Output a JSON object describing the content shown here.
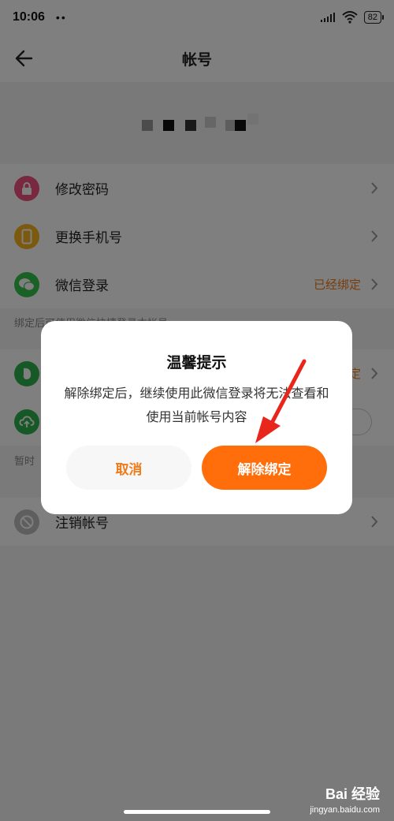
{
  "status_bar": {
    "time": "10:06",
    "dots": "••",
    "battery": "82"
  },
  "nav": {
    "title": "帐号"
  },
  "menu": {
    "change_password": "修改密码",
    "change_phone": "更换手机号",
    "wechat_login": {
      "label": "微信登录",
      "value": "已经绑定"
    },
    "wechat_hint": "绑定后可使用微信快捷登录本帐号",
    "row4_value": "定",
    "hint2_prefix": "暂时",
    "deregister": "注销帐号"
  },
  "dialog": {
    "title": "温馨提示",
    "message": "解除绑定后，继续使用此微信登录将无法查看和使用当前帐号内容",
    "cancel": "取消",
    "confirm": "解除绑定"
  },
  "watermark": {
    "main": "Bai 经验",
    "sub": "jingyan.baidu.com"
  },
  "colors": {
    "accent": "#ff6e0b",
    "accent_text": "#ef7a1a"
  }
}
